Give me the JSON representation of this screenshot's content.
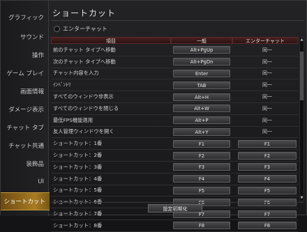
{
  "sidebar": {
    "items": [
      {
        "label": "グラフィック"
      },
      {
        "label": "サウンド"
      },
      {
        "label": "操作"
      },
      {
        "label": "ゲーム プレイ"
      },
      {
        "label": "画面情報"
      },
      {
        "label": "ダメージ表示"
      },
      {
        "label": "チャット タブ"
      },
      {
        "label": "チャット共通"
      },
      {
        "label": "装飾品"
      },
      {
        "label": "UI"
      },
      {
        "label": "ショートカット"
      }
    ],
    "active_index": 10
  },
  "main": {
    "title": "ショートカット",
    "enter_chat_checkbox": {
      "label": "エンターチャット",
      "checked": false
    },
    "columns": [
      "項目",
      "一般",
      "エンターチャット"
    ],
    "rows": [
      {
        "label": "前のチャット タイプへ移動",
        "general": "Alt+PgUp",
        "enter": "同一"
      },
      {
        "label": "次のチャット タイプへ移動",
        "general": "Alt+PgDn",
        "enter": "同一"
      },
      {
        "label": "チャット内容を入力",
        "general": "Enter",
        "enter": "同一"
      },
      {
        "label": "ｲﾝﾍﾞﾝﾄﾘ",
        "general": "TAB",
        "enter": "同一"
      },
      {
        "label": "すべてのウィンドウ非表示",
        "general": "Alt+H",
        "enter": "同一"
      },
      {
        "label": "すべてのウィンドウを閉じる",
        "general": "Alt+W",
        "enter": "同一"
      },
      {
        "label": "最低FPS機能適用",
        "general": "Alt+P",
        "enter": "同一"
      },
      {
        "label": "友人管理ウィンドウを開く",
        "general": "Alt+Y",
        "enter": "同一"
      },
      {
        "label": "ショートカット：1番",
        "general": "F1",
        "enter": "F1"
      },
      {
        "label": "ショートカット：2番",
        "general": "F2",
        "enter": "F2"
      },
      {
        "label": "ショートカット：3番",
        "general": "F3",
        "enter": "F3"
      },
      {
        "label": "ショートカット：4番",
        "general": "F4",
        "enter": "F4"
      },
      {
        "label": "ショートカット：5番",
        "general": "F5",
        "enter": "F5"
      },
      {
        "label": "ショートカット：6番",
        "general": "F6",
        "enter": "F6"
      },
      {
        "label": "ショートカット：7番",
        "general": "F7",
        "enter": "F7"
      },
      {
        "label": "ショートカット：8番",
        "general": "F8",
        "enter": "F8"
      }
    ],
    "reset_label": "設定初期化"
  },
  "colors": {
    "accent": "#a87b22",
    "header_bg": "#4a1f1f",
    "window_bg": "#1e1e20"
  }
}
